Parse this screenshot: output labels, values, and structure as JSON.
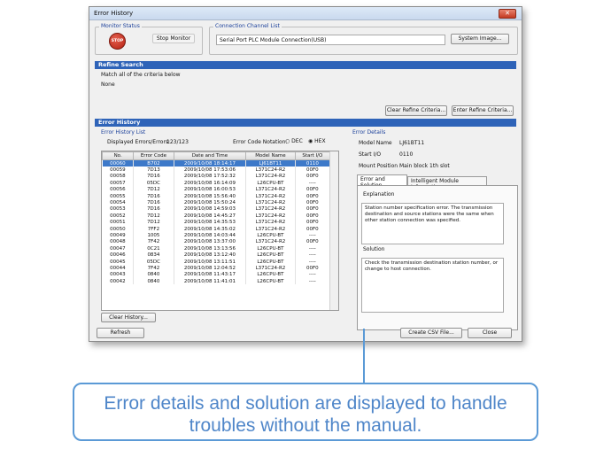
{
  "window": {
    "title": "Error History",
    "close_glyph": "✕"
  },
  "monitor_status": {
    "label": "Monitor Status",
    "stop_icon_text": "STOP",
    "button": "Stop Monitor"
  },
  "connection": {
    "label": "Connection Channel List",
    "value": "Serial Port PLC Module Connection(USB)",
    "button": "System Image..."
  },
  "refine": {
    "title": "Refine Search",
    "match_text": "Match all of the criteria below",
    "criteria": "None",
    "clear_button": "Clear Refine Criteria...",
    "enter_button": "Enter Refine Criteria..."
  },
  "error_history": {
    "title": "Error History",
    "list_label": "Error History List",
    "displayed_label": "Displayed Errors/Errors:",
    "displayed_value": "123/123",
    "notation_label": "Error Code Notation:",
    "notation_dec": "DEC",
    "notation_hex": "HEX",
    "columns": [
      "No.",
      "Error Code",
      "Date and Time",
      "Model Name",
      "Start I/O"
    ],
    "rows": [
      [
        "00060",
        "B702",
        "2009/10/08 18:14:17",
        "LJ61BT11",
        "0110"
      ],
      [
        "00059",
        "7D13",
        "2009/10/08 17:53:06",
        "L371C24-R2",
        "00F0"
      ],
      [
        "00058",
        "7D16",
        "2009/10/08 17:52:32",
        "L371C24-R2",
        "00F0"
      ],
      [
        "00057",
        "05DC",
        "2009/10/08 16:14:09",
        "L26CPU-BT",
        "----"
      ],
      [
        "00056",
        "7D12",
        "2009/10/08 16:00:53",
        "L371C24-R2",
        "00F0"
      ],
      [
        "00055",
        "7D16",
        "2009/10/08 15:56:40",
        "L371C24-R2",
        "00F0"
      ],
      [
        "00054",
        "7D16",
        "2009/10/08 15:50:24",
        "L371C24-R2",
        "00F0"
      ],
      [
        "00053",
        "7D16",
        "2009/10/08 14:59:03",
        "L371C24-R2",
        "00F0"
      ],
      [
        "00052",
        "7D12",
        "2009/10/08 14:45:27",
        "L371C24-R2",
        "00F0"
      ],
      [
        "00051",
        "7D12",
        "2009/10/08 14:35:53",
        "L371C24-R2",
        "00F0"
      ],
      [
        "00050",
        "7FF2",
        "2009/10/08 14:35:02",
        "L371C24-R2",
        "00F0"
      ],
      [
        "00049",
        "1005",
        "2009/10/08 14:03:44",
        "L26CPU-BT",
        "----"
      ],
      [
        "00048",
        "7F42",
        "2009/10/08 13:37:00",
        "L371C24-R2",
        "00F0"
      ],
      [
        "00047",
        "0C21",
        "2009/10/08 13:13:56",
        "L26CPU-BT",
        "----"
      ],
      [
        "00046",
        "0834",
        "2009/10/08 13:12:40",
        "L26CPU-BT",
        "----"
      ],
      [
        "00045",
        "05DC",
        "2009/10/08 13:11:51",
        "L26CPU-BT",
        "----"
      ],
      [
        "00044",
        "7F42",
        "2009/10/08 12:04:52",
        "L371C24-R2",
        "00F0"
      ],
      [
        "00043",
        "0840",
        "2009/10/08 11:43:17",
        "L26CPU-BT",
        "----"
      ],
      [
        "00042",
        "0840",
        "2009/10/08 11:41:01",
        "L26CPU-BT",
        "----"
      ]
    ],
    "clear_history_button": "Clear History..."
  },
  "error_details": {
    "title": "Error Details",
    "model_label": "Model Name",
    "model_value": "LJ61BT11",
    "start_label": "Start I/O",
    "start_value": "0110",
    "mount_label": "Mount Position",
    "mount_value": "Main block 1th slot",
    "tab_error": "Error and Solution",
    "tab_module": "Intelligent Module Information",
    "explanation_label": "Explanation",
    "explanation_lines": [
      "Station number specification error. The transmission",
      "destination and source stations were the same when",
      "other station connection was specified."
    ],
    "solution_label": "Solution",
    "solution_lines": [
      "Check the transmission destination station number, or",
      "change to host connection."
    ]
  },
  "footer": {
    "refresh": "Refresh",
    "csv": "Create CSV File...",
    "close": "Close"
  },
  "callout": {
    "line1": "Error details and solution are displayed to handle",
    "line2": "troubles without the manual."
  }
}
